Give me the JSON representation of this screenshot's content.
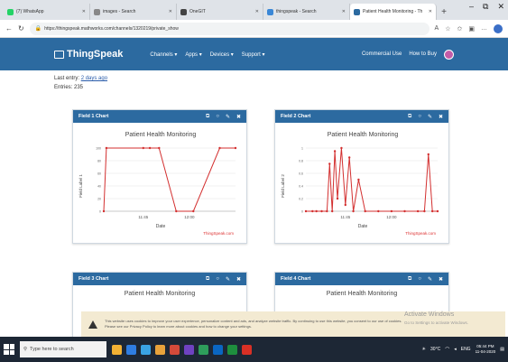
{
  "browser": {
    "tabs": [
      {
        "label": "(7) WhatsApp",
        "color": "#25d366"
      },
      {
        "label": "images - Search",
        "color": "#888888"
      },
      {
        "label": "OneGIT",
        "color": "#444444"
      },
      {
        "label": "thingspeak - Search",
        "color": "#3a87d6"
      },
      {
        "label": "Patient Health Monitoring - Th",
        "color": "#2c6aa0"
      }
    ],
    "new_tab": "+",
    "url": "https://thingspeak.mathworks.com/channels/1320219/private_show",
    "window_controls": [
      "–",
      "⧉",
      "✕"
    ]
  },
  "nav": {
    "logo": "ThingSpeak",
    "menu": [
      "Channels ▾",
      "Apps ▾",
      "Devices ▾",
      "Support ▾"
    ],
    "right": [
      "Commercial Use",
      "How to Buy"
    ],
    "avatar_letter": "S"
  },
  "meta": {
    "last_entry_label": "Last entry:",
    "last_entry_value": "2 days ago",
    "entries": "Entries: 235"
  },
  "cards": [
    {
      "title": "Field 1 Chart",
      "chart": "Patient Health Monitoring",
      "ylabel": "Field Label 1",
      "xlabel": "Date",
      "credit": "ThingSpeak.com",
      "xticks": [
        "11:45",
        "12:00"
      ]
    },
    {
      "title": "Field 2 Chart",
      "chart": "Patient Health Monitoring",
      "ylabel": "Field Label 2",
      "xlabel": "Date",
      "credit": "ThingSpeak.com",
      "xticks": [
        "11:45",
        "12:00"
      ]
    },
    {
      "title": "Field 3 Chart",
      "chart": "Patient Health Monitoring"
    },
    {
      "title": "Field 4 Chart",
      "chart": "Patient Health Monitoring"
    }
  ],
  "card_tools": [
    "⧉",
    "○",
    "✎",
    "✖"
  ],
  "cookie": {
    "text": "This website uses cookies to improve your user experience, personalize content and ads, and analyze website traffic. By continuing to use this website, you consent to our use of cookies. Please see our Privacy Policy to learn more about cookies and how to change your settings."
  },
  "activate": {
    "title": "Activate Windows",
    "sub": "Go to Settings to activate Windows."
  },
  "taskbar": {
    "search_placeholder": "Type here to search",
    "apps": [
      "#f2b134",
      "#2f7de1",
      "#3aa3e3",
      "#e8a23b",
      "#d44a3a",
      "#6f42c1",
      "#2e9d5b",
      "#0a66c2",
      "#1e8e3e",
      "#d93025"
    ],
    "weather": "30°C",
    "tray_text": "ENG",
    "time": "05:44 PM",
    "date": "11-04-2020"
  },
  "chart_data": [
    {
      "type": "line",
      "title": "Patient Health Monitoring",
      "xlabel": "Date",
      "ylabel": "Field Label 1",
      "x": [
        0.0,
        0.02,
        0.3,
        0.35,
        0.42,
        0.55,
        0.68,
        0.88,
        1.0
      ],
      "y": [
        0.0,
        100,
        100,
        100,
        100,
        0,
        0,
        100,
        100
      ],
      "ylim": [
        0,
        100
      ],
      "xticks": [
        "11:45",
        "12:00"
      ]
    },
    {
      "type": "line",
      "title": "Patient Health Monitoring",
      "xlabel": "Date",
      "ylabel": "Field Label 2",
      "x": [
        0.0,
        0.05,
        0.08,
        0.12,
        0.16,
        0.18,
        0.2,
        0.22,
        0.24,
        0.27,
        0.3,
        0.33,
        0.36,
        0.4,
        0.45,
        0.55,
        0.65,
        0.75,
        0.85,
        0.9,
        0.93,
        0.96,
        1.0
      ],
      "y": [
        0.0,
        0.0,
        0.0,
        0.0,
        0.0,
        0.75,
        0.0,
        0.95,
        0.2,
        1.0,
        0.1,
        0.85,
        0.0,
        0.5,
        0.0,
        0.0,
        0.0,
        0.0,
        0.0,
        0.0,
        0.9,
        0.0,
        0.0
      ],
      "ylim": [
        0,
        1
      ],
      "xticks": [
        "11:45",
        "12:00"
      ]
    }
  ]
}
